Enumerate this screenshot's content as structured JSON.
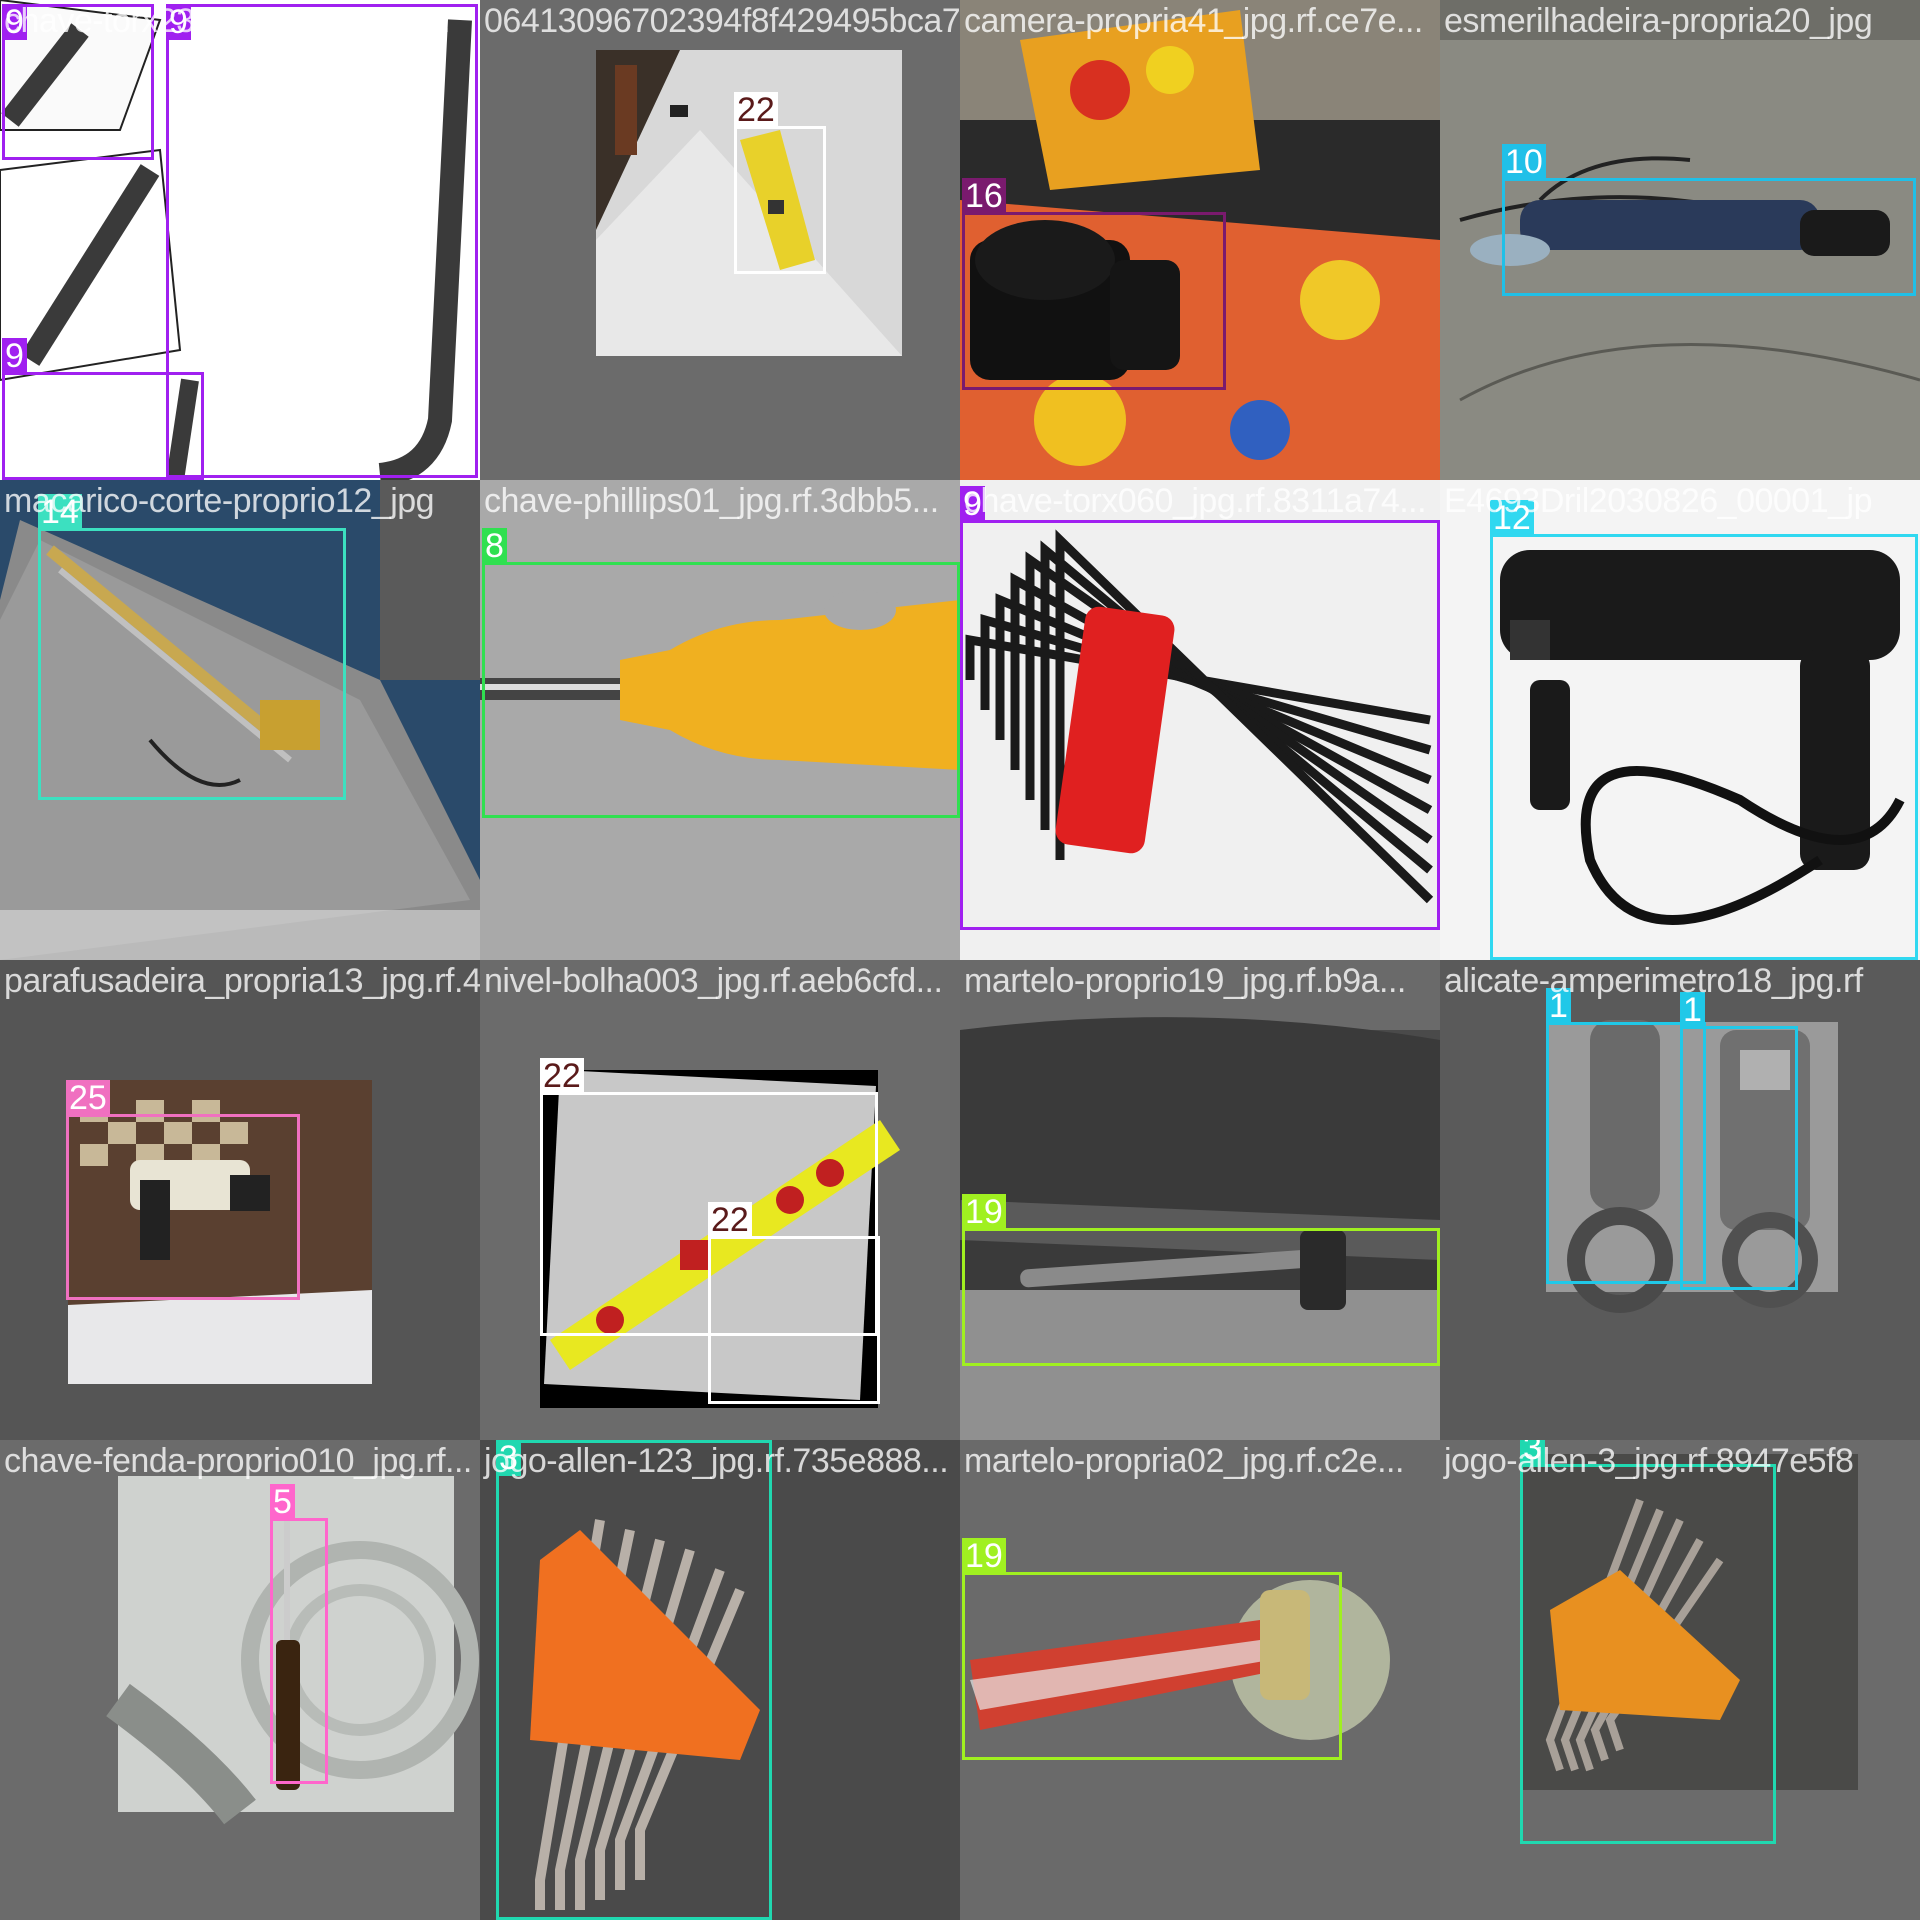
{
  "colors": {
    "class_9": "#a020f0",
    "class_22": "#ffffff",
    "class_16": "#7a1a6e",
    "class_10": "#20c0e8",
    "class_14": "#3ce0c0",
    "class_8": "#30e050",
    "class_12": "#30d8f0",
    "class_25": "#f070c0",
    "class_19": "#a0f020",
    "class_1": "#20c8e8",
    "class_5": "#ff66cc",
    "class_3": "#20d8b0"
  },
  "tiles": [
    {
      "filename": "chave-torx23_jpg.rf.0149618...",
      "labels": [
        "9",
        "9",
        "9"
      ]
    },
    {
      "filename": "06413096702394f8f429495bca7...",
      "labels": [
        "22"
      ]
    },
    {
      "filename": "camera-propria41_jpg.rf.ce7e...",
      "labels": [
        "16"
      ]
    },
    {
      "filename": "esmerilhadeira-propria20_jpg",
      "labels": [
        "10"
      ]
    },
    {
      "filename": "macarico-corte-proprio12_jpg",
      "labels": [
        "14"
      ]
    },
    {
      "filename": "chave-phillips01_jpg.rf.3dbb5...",
      "labels": [
        "8"
      ]
    },
    {
      "filename": "chave-torx060_jpg.rf.8311a74...",
      "labels": [
        "9"
      ]
    },
    {
      "filename": "E4693Dril2030826_00001_jp",
      "labels": [
        "12"
      ]
    },
    {
      "filename": "parafusadeira_propria13_jpg.rf.4...",
      "labels": [
        "25"
      ]
    },
    {
      "filename": "nivel-bolha003_jpg.rf.aeb6cfd...",
      "labels": [
        "22",
        "22"
      ]
    },
    {
      "filename": "martelo-proprio19_jpg.rf.b9a...",
      "labels": [
        "19"
      ]
    },
    {
      "filename": "alicate-amperimetro18_jpg.rf",
      "labels": [
        "1",
        "1"
      ]
    },
    {
      "filename": "chave-fenda-proprio010_jpg.rf...",
      "labels": [
        "5"
      ]
    },
    {
      "filename": "jogo-allen-123_jpg.rf.735e888...",
      "labels": [
        "3"
      ]
    },
    {
      "filename": "martelo-propria02_jpg.rf.c2e...",
      "labels": [
        "19"
      ]
    },
    {
      "filename": "jogo-allen-3_jpg.rf.8947e5f8",
      "labels": [
        "3"
      ]
    }
  ]
}
